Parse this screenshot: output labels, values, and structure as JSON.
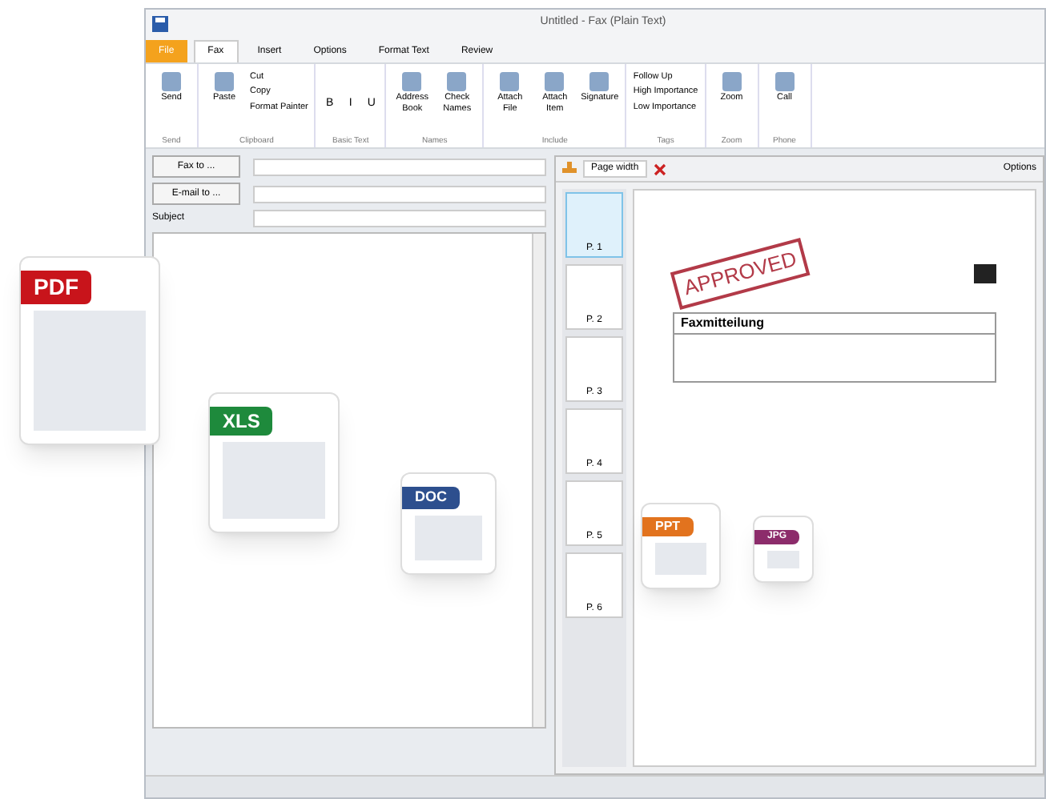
{
  "window": {
    "title": "Untitled - Fax (Plain Text)"
  },
  "tabs": [
    {
      "label": "File",
      "selected": false,
      "kind": "file"
    },
    {
      "label": "Fax",
      "selected": true,
      "kind": "tab"
    },
    {
      "label": "Insert",
      "selected": false,
      "kind": "tab"
    },
    {
      "label": "Options",
      "selected": false,
      "kind": "tab"
    },
    {
      "label": "Format Text",
      "selected": false,
      "kind": "tab"
    },
    {
      "label": "Review",
      "selected": false,
      "kind": "tab"
    }
  ],
  "ribbon_groups": [
    {
      "label": "Send",
      "items": [
        {
          "label": "Send",
          "kind": "large"
        }
      ]
    },
    {
      "label": "Clipboard",
      "items": [
        {
          "label": "Paste",
          "kind": "large"
        },
        {
          "label": "Cut",
          "kind": "small"
        },
        {
          "label": "Copy",
          "kind": "small"
        },
        {
          "label": "Format Painter",
          "kind": "small"
        }
      ]
    },
    {
      "label": "Basic Text",
      "items": [
        {
          "label": "B",
          "kind": "format"
        },
        {
          "label": "I",
          "kind": "format"
        },
        {
          "label": "U",
          "kind": "format"
        }
      ]
    },
    {
      "label": "Names",
      "items": [
        {
          "label": "Address Book",
          "kind": "large"
        },
        {
          "label": "Check Names",
          "kind": "large"
        }
      ]
    },
    {
      "label": "Include",
      "items": [
        {
          "label": "Attach File",
          "kind": "large"
        },
        {
          "label": "Attach Item",
          "kind": "large"
        },
        {
          "label": "Signature",
          "kind": "large"
        }
      ]
    },
    {
      "label": "Tags",
      "items": [
        {
          "label": "Follow Up",
          "kind": "small"
        },
        {
          "label": "High Importance",
          "kind": "small"
        },
        {
          "label": "Low Importance",
          "kind": "small"
        }
      ]
    },
    {
      "label": "Zoom",
      "items": [
        {
          "label": "Zoom",
          "kind": "large"
        }
      ]
    },
    {
      "label": "Phone",
      "items": [
        {
          "label": "Call",
          "kind": "large"
        }
      ]
    }
  ],
  "compose": {
    "fax_to_button": "Fax to ...",
    "email_to_button": "E-mail to ...",
    "subject_label": "Subject"
  },
  "preview": {
    "zoom": "Page width",
    "options": "Options",
    "stamp": "APPROVED",
    "doc_title": "Faxmitteilung",
    "thumbnails": [
      {
        "label": "P. 1",
        "selected": true
      },
      {
        "label": "P. 2",
        "selected": false
      },
      {
        "label": "P. 3",
        "selected": false
      },
      {
        "label": "P. 4",
        "selected": false
      },
      {
        "label": "P. 5",
        "selected": false
      },
      {
        "label": "P. 6",
        "selected": false
      }
    ]
  },
  "file_icons": [
    {
      "label": "PDF",
      "kind": "pdf"
    },
    {
      "label": "XLS",
      "kind": "xls"
    },
    {
      "label": "DOC",
      "kind": "doc"
    },
    {
      "label": "PPT",
      "kind": "ppt"
    },
    {
      "label": "JPG",
      "kind": "jpg"
    }
  ]
}
